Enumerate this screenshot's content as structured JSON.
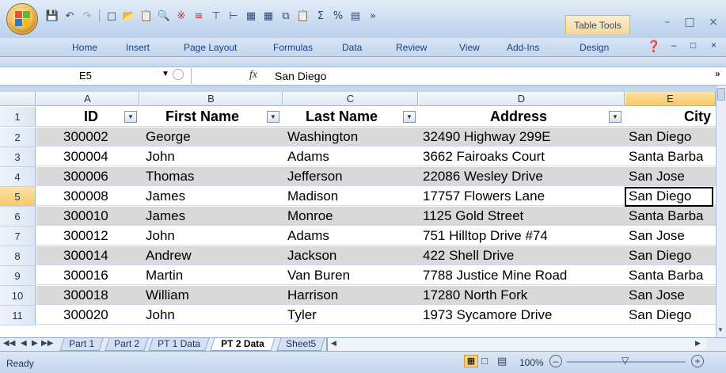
{
  "ribbon": {
    "context_tab": "Table Tools",
    "tabs": [
      "Home",
      "Insert",
      "Page Layout",
      "Formulas",
      "Data",
      "Review",
      "View",
      "Add-Ins",
      "Design"
    ]
  },
  "formula_bar": {
    "name_box": "E5",
    "fx_symbol": "fx",
    "formula_value": "San Diego"
  },
  "grid": {
    "columns": [
      "A",
      "B",
      "C",
      "D",
      "E"
    ],
    "selected_column": "E",
    "headers": [
      "ID",
      "First Name",
      "Last Name",
      "Address",
      "City"
    ],
    "rows": [
      {
        "num": "2",
        "id": "300002",
        "first": "George",
        "last": "Washington",
        "address": "32490 Highway 299E",
        "city": "San Diego"
      },
      {
        "num": "3",
        "id": "300004",
        "first": "John",
        "last": "Adams",
        "address": "3662 Fairoaks Court",
        "city": "Santa Barba"
      },
      {
        "num": "4",
        "id": "300006",
        "first": "Thomas",
        "last": "Jefferson",
        "address": "22086 Wesley Drive",
        "city": "San Jose"
      },
      {
        "num": "5",
        "id": "300008",
        "first": "James",
        "last": "Madison",
        "address": "17757 Flowers Lane",
        "city": "San Diego"
      },
      {
        "num": "6",
        "id": "300010",
        "first": "James",
        "last": "Monroe",
        "address": "1125 Gold Street",
        "city": "Santa Barba"
      },
      {
        "num": "7",
        "id": "300012",
        "first": "John",
        "last": "Adams",
        "address": "751 Hilltop Drive #74",
        "city": "San Jose"
      },
      {
        "num": "8",
        "id": "300014",
        "first": "Andrew",
        "last": "Jackson",
        "address": "422 Shell Drive",
        "city": "San Diego"
      },
      {
        "num": "9",
        "id": "300016",
        "first": "Martin",
        "last": "Van Buren",
        "address": "7788 Justice Mine Road",
        "city": "Santa Barba"
      },
      {
        "num": "10",
        "id": "300018",
        "first": "William",
        "last": "Harrison",
        "address": "17280 North Fork",
        "city": "San Jose"
      },
      {
        "num": "11",
        "id": "300020",
        "first": "John",
        "last": "Tyler",
        "address": "1973 Sycamore Drive",
        "city": "San Diego"
      }
    ],
    "header_row_num": "1",
    "selected_row": "5",
    "active_cell": "E5"
  },
  "sheets": {
    "tabs": [
      "Part 1",
      "Part 2",
      "PT 1 Data",
      "PT 2 Data",
      "Sheet5"
    ],
    "active": "PT 2 Data"
  },
  "status": {
    "ready": "Ready",
    "zoom": "100%"
  },
  "colors": {
    "band": "#d9d9d9",
    "selected_header": "#f8c968"
  }
}
